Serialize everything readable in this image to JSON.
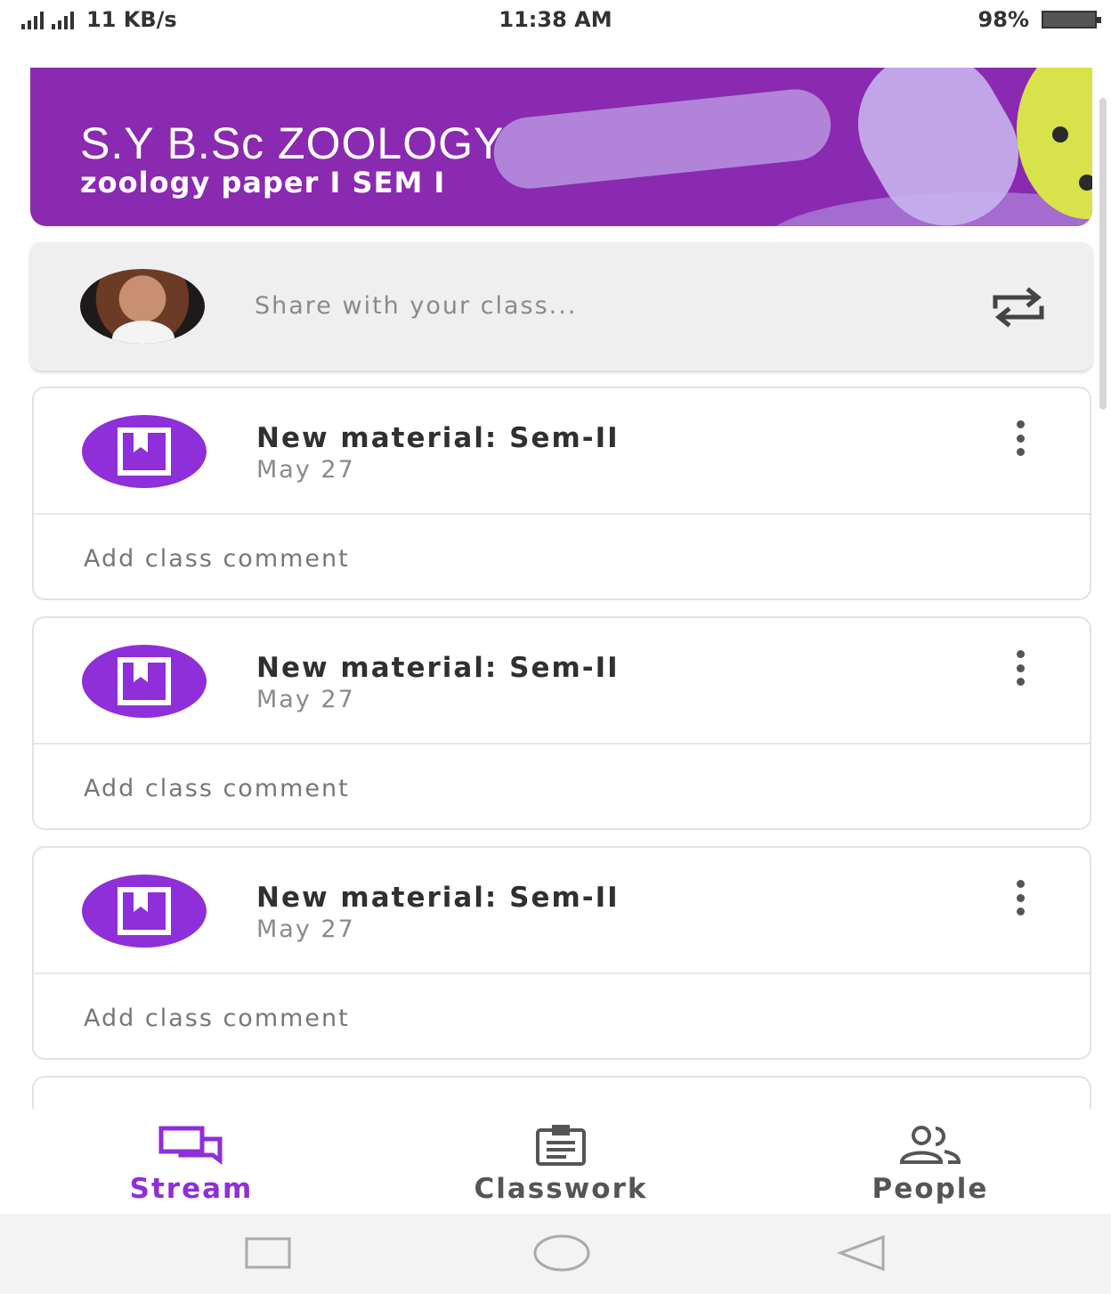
{
  "status_bar": {
    "speed": "11 KB/s",
    "time": "11:38 AM",
    "battery": "98%"
  },
  "banner": {
    "title": "S.Y B.Sc ZOOLOGY",
    "subtitle": "zoology paper I SEM I",
    "color": "#8a2ab0"
  },
  "share": {
    "placeholder": "Share with your class..."
  },
  "posts": [
    {
      "title": "New material: Sem-II",
      "date": "May 27",
      "comment_prompt": "Add class comment"
    },
    {
      "title": "New material: Sem-II",
      "date": "May 27",
      "comment_prompt": "Add class comment"
    },
    {
      "title": "New material: Sem-II",
      "date": "May 27",
      "comment_prompt": "Add class comment"
    }
  ],
  "bottom_nav": {
    "items": [
      {
        "label": "Stream",
        "icon": "stream-icon",
        "active": true
      },
      {
        "label": "Classwork",
        "icon": "classwork-icon",
        "active": false
      },
      {
        "label": "People",
        "icon": "people-icon",
        "active": false
      }
    ]
  },
  "colors": {
    "accent": "#8e2fd9",
    "banner": "#8a2ab0"
  },
  "system_nav": {
    "icons": [
      "recents-icon",
      "home-icon",
      "back-icon"
    ]
  }
}
